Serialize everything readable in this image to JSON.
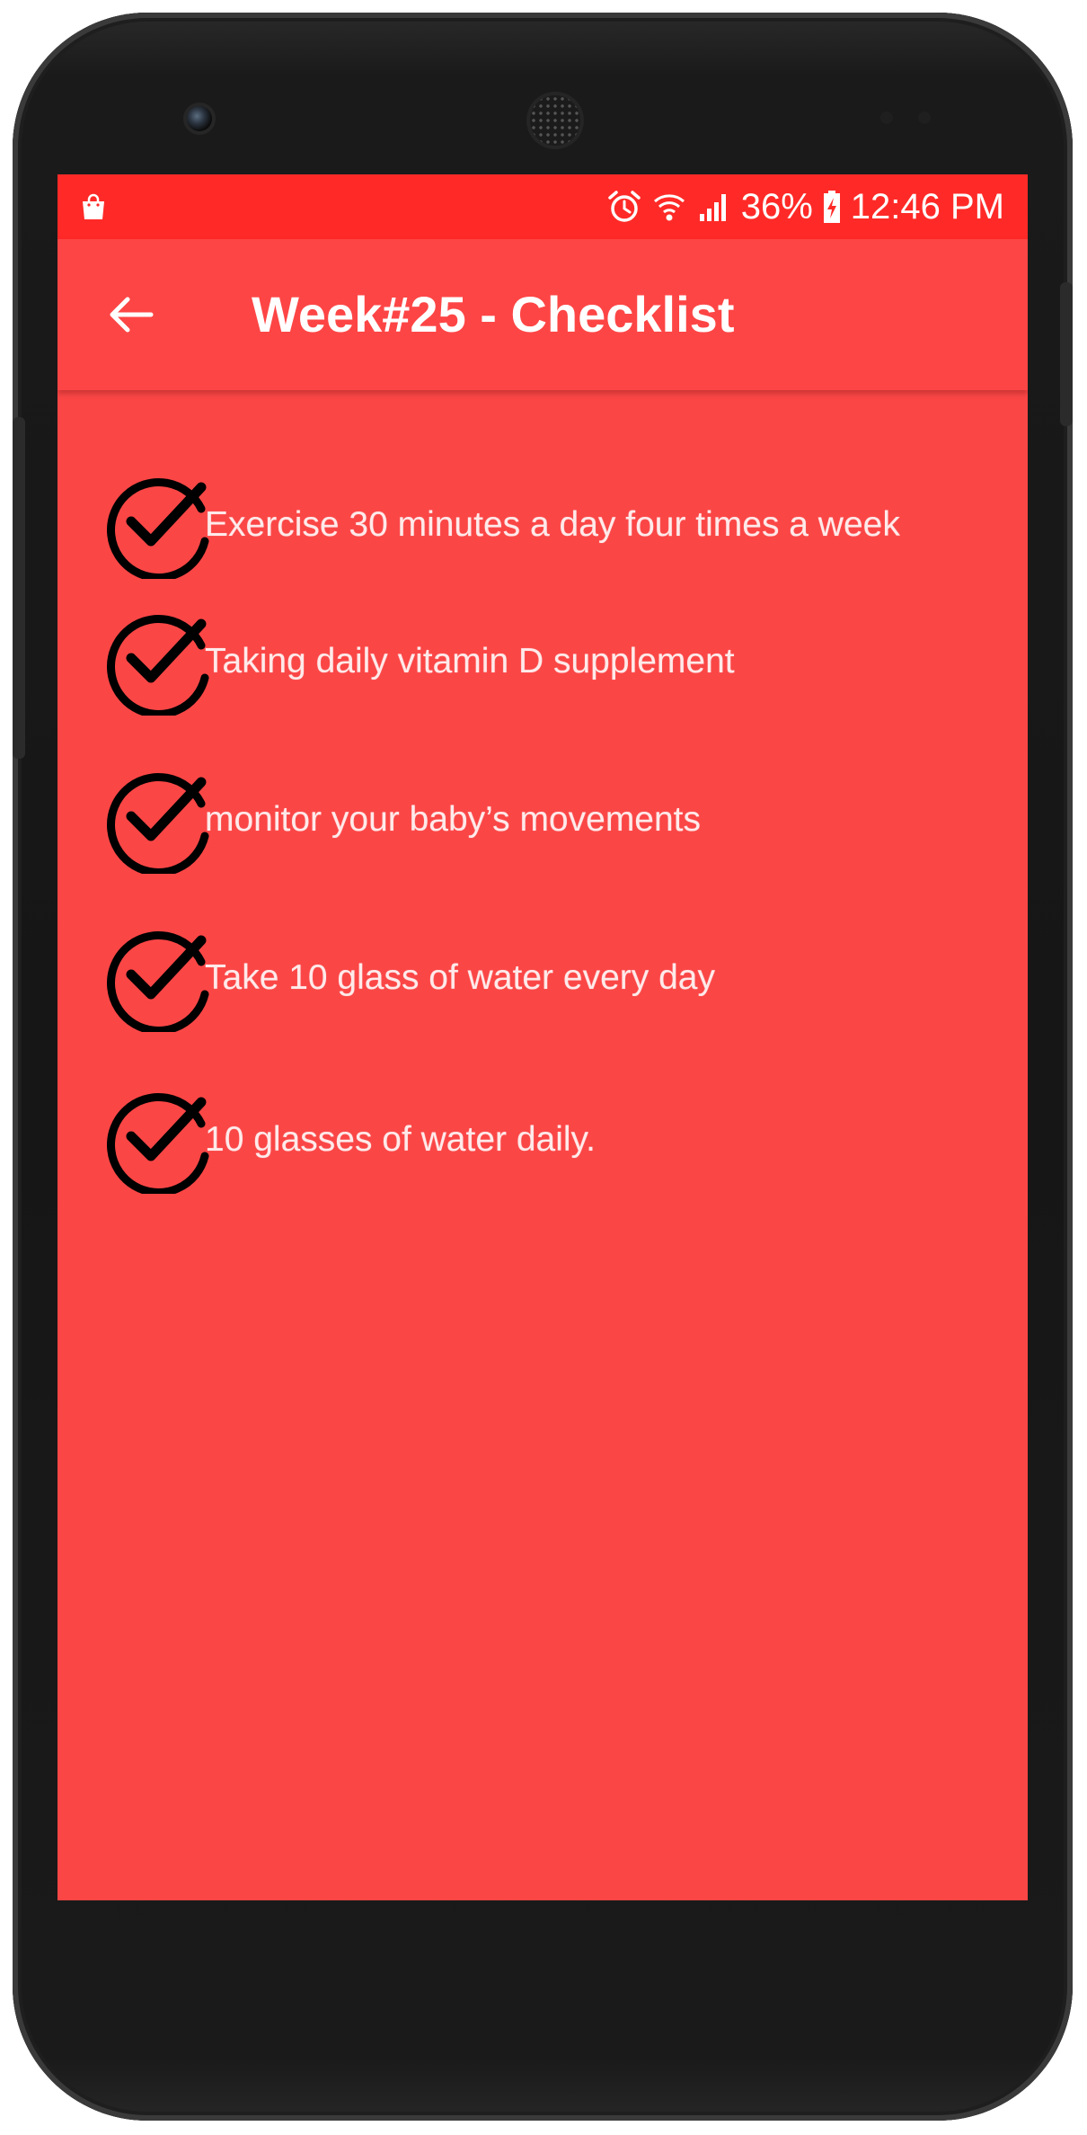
{
  "status_bar": {
    "left_icon": "shopping-bag-icon",
    "icons": [
      "alarm-icon",
      "wifi-icon",
      "signal-icon"
    ],
    "battery_percent": "36%",
    "battery_icon": "battery-charging-icon",
    "time": "12:46 PM"
  },
  "app_bar": {
    "back_icon": "arrow-back-icon",
    "title": "Week#25 - Checklist"
  },
  "checklist": {
    "icon": "check-circle-icon",
    "items": [
      {
        "label": "Exercise  30 minutes a day four times a week"
      },
      {
        "label": "Taking daily vitamin D supplement"
      },
      {
        "label": "monitor your baby’s movements"
      },
      {
        "label": "Take 10 glass of water every day"
      },
      {
        "label": "10 glasses of water daily."
      }
    ]
  },
  "colors": {
    "status_bar": "#ff2a27",
    "app_bar": "#fe4545",
    "background": "#fb4646",
    "text": "#ffffff",
    "icon": "#000000"
  }
}
